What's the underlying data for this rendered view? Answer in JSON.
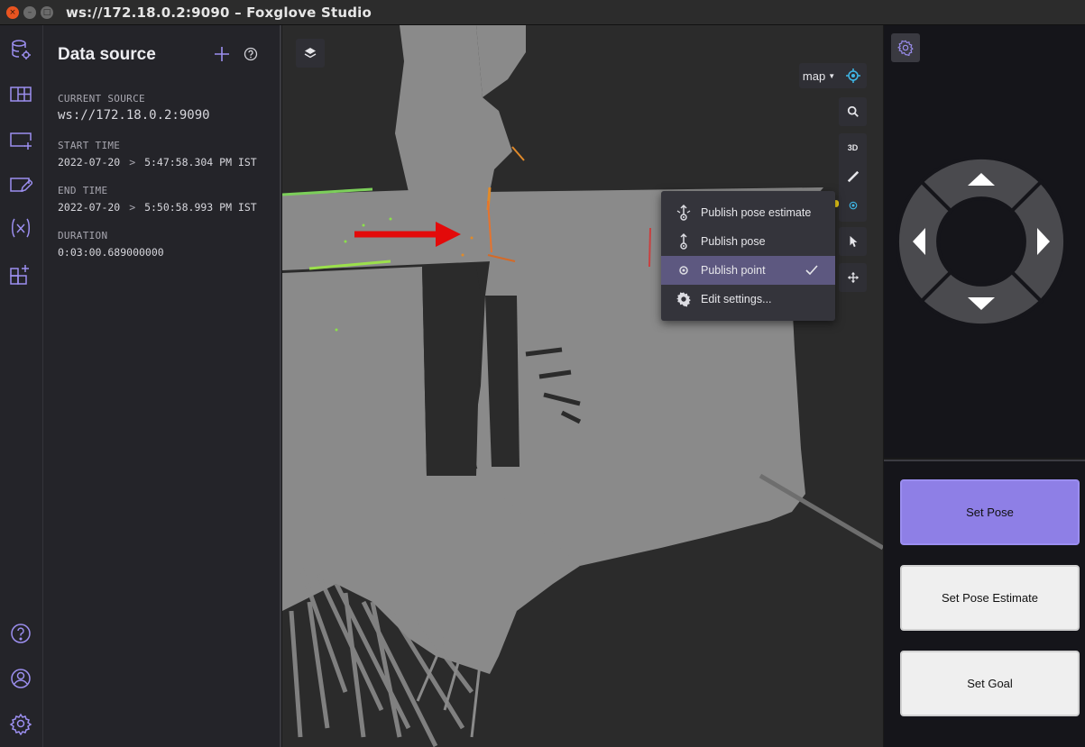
{
  "window": {
    "title": "ws://172.18.0.2:9090 – Foxglove Studio",
    "close_glyph": "×",
    "minimize_glyph": "–",
    "maximize_glyph": "□"
  },
  "sidebar": {
    "icons": [
      "data-source-icon",
      "layouts-icon",
      "add-panel-icon",
      "panel-settings-icon",
      "variables-icon",
      "extensions-icon",
      "help-icon",
      "account-icon",
      "settings-icon"
    ]
  },
  "data_source": {
    "title": "Data source",
    "current_source_label": "CURRENT SOURCE",
    "current_source_value": "ws://172.18.0.2:9090",
    "start_time_label": "START TIME",
    "start_date": "2022-07-20",
    "start_time": "5:47:58.304 PM IST",
    "end_time_label": "END TIME",
    "end_date": "2022-07-20",
    "end_time": "5:50:58.993 PM IST",
    "duration_label": "DURATION",
    "duration_value": "0:03:00.689000000"
  },
  "map_panel": {
    "frame": "map",
    "toolbar_3d_label": "3D"
  },
  "publish_menu": {
    "items": [
      {
        "label": "Publish pose estimate"
      },
      {
        "label": "Publish pose"
      },
      {
        "label": "Publish point",
        "selected": true
      },
      {
        "label": "Edit settings..."
      }
    ]
  },
  "teleop": {
    "directions": [
      "up",
      "left",
      "right",
      "down"
    ]
  },
  "buttons": {
    "set_pose": "Set Pose",
    "set_pose_estimate": "Set Pose Estimate",
    "set_goal": "Set Goal"
  },
  "colors": {
    "accent": "#8e7fe6",
    "annotation_arrow": "#e30a0a",
    "menu_selected": "#5d5880"
  }
}
